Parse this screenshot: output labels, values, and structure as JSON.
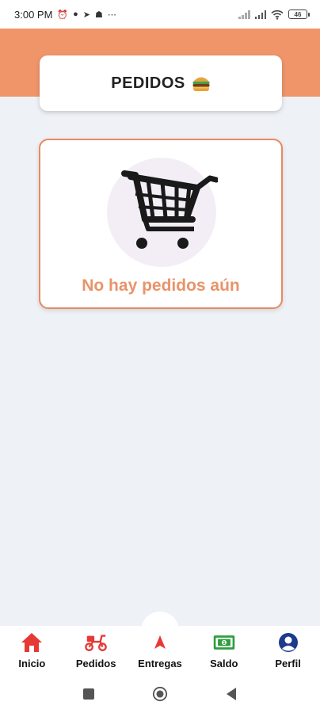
{
  "status_bar": {
    "time": "3:00 PM",
    "notification_dots": "⋯",
    "battery_level": "46"
  },
  "header": {
    "title": "PEDIDOS"
  },
  "empty_state": {
    "message": "No hay pedidos aún"
  },
  "bottom_nav": {
    "items": [
      {
        "label": "Inicio",
        "icon": "home-icon",
        "color": "#e53935"
      },
      {
        "label": "Pedidos",
        "icon": "scooter-icon",
        "color": "#e53935"
      },
      {
        "label": "Entregas",
        "icon": "navigation-arrow-icon",
        "color": "#e53935"
      },
      {
        "label": "Saldo",
        "icon": "money-icon",
        "color": "#2e9e3f"
      },
      {
        "label": "Perfil",
        "icon": "user-icon",
        "color": "#1e3a8a"
      }
    ]
  },
  "colors": {
    "header_orange": "#f0956a",
    "accent_orange": "#e88a5f",
    "background": "#eef1f6"
  }
}
